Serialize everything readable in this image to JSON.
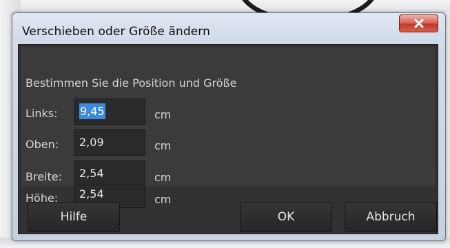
{
  "dialog": {
    "title": "Verschieben oder Größe ändern",
    "close_icon": "close-icon",
    "heading": "Bestimmen Sie die Position und Größe",
    "fields": [
      {
        "label": "Links:",
        "value": "9,45",
        "unit": "cm",
        "selected": true
      },
      {
        "label": "Oben:",
        "value": "2,09",
        "unit": "cm",
        "selected": false
      },
      {
        "label": "Breite:",
        "value": "2,54",
        "unit": "cm",
        "selected": false
      },
      {
        "label": "Höhe:",
        "value": "2,54",
        "unit": "cm",
        "selected": false
      }
    ],
    "buttons": {
      "help": "Hilfe",
      "ok": "OK",
      "cancel": "Abbruch"
    }
  },
  "colors": {
    "client_bg": "#323232",
    "selection": "#3d8bde",
    "close_button": "#c13a2b"
  }
}
